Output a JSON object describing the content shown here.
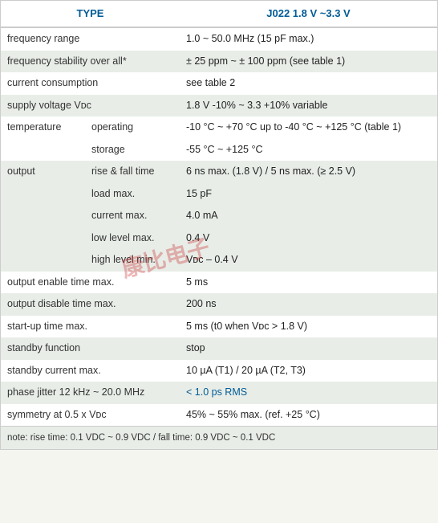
{
  "header": {
    "type_label": "TYPE",
    "model_label": "J022 1.8 V ~3.3 V"
  },
  "rows": [
    {
      "id": "frequency-range",
      "category": "frequency range",
      "sub": "",
      "value": "1.0 ~ 50.0 MHz (15 pF max.)",
      "shade": "odd"
    },
    {
      "id": "frequency-stability",
      "category": "frequency stability over all*",
      "sub": "",
      "value": "± 25 ppm ~ ± 100 ppm (see table 1)",
      "shade": "even"
    },
    {
      "id": "current-consumption",
      "category": "current consumption",
      "sub": "",
      "value": "see table 2",
      "shade": "odd"
    },
    {
      "id": "supply-voltage",
      "category": "supply voltage Vᴅᴄ",
      "sub": "",
      "value": "1.8 V -10% ~ 3.3 +10% variable",
      "shade": "even"
    }
  ],
  "temperature": {
    "category": "temperature",
    "sub_rows": [
      {
        "sub": "operating",
        "value": "-10 °C ~ +70 °C up to -40 °C ~ +125 °C (table 1)"
      },
      {
        "sub": "storage",
        "value": "-55 °C ~ +125 °C"
      }
    ],
    "shade": "odd"
  },
  "output": {
    "category": "output",
    "sub_rows": [
      {
        "sub": "rise & fall time",
        "value": "6 ns max. (1.8 V) / 5 ns max. (≥ 2.5 V)"
      },
      {
        "sub": "load max.",
        "value": "15 pF"
      },
      {
        "sub": "current max.",
        "value": "4.0 mA"
      },
      {
        "sub": "low level max.",
        "value": "0.4 V"
      },
      {
        "sub": "high level min.",
        "value": "Vᴅᴄ – 0.4 V"
      }
    ],
    "shade": "even"
  },
  "rows2": [
    {
      "id": "output-enable",
      "category": "output enable time max.",
      "value": "5 ms",
      "shade": "odd"
    },
    {
      "id": "output-disable",
      "category": "output disable time max.",
      "value": "200 ns",
      "shade": "even"
    },
    {
      "id": "startup-time",
      "category": "start-up time max.",
      "value": "5 ms (t0 when Vᴅᴄ > 1.8 V)",
      "shade": "odd"
    },
    {
      "id": "standby-function",
      "category": "standby function",
      "value": "stop",
      "shade": "even"
    },
    {
      "id": "standby-current",
      "category": "standby current max.",
      "value": "10 µA (T1) / 20 µA (T2, T3)",
      "shade": "odd"
    },
    {
      "id": "phase-jitter",
      "category": "phase jitter 12 kHz ~ 20.0 MHz",
      "value": "< 1.0 ps RMS",
      "shade": "even",
      "value_blue": true
    },
    {
      "id": "symmetry",
      "category": "symmetry at 0.5 x Vᴅᴄ",
      "value": "45% ~ 55% max. (ref. +25 °C)",
      "shade": "odd"
    }
  ],
  "note": "note: rise time: 0.1 VDC ~ 0.9 VDC / fall time: 0.9 VDC ~ 0.1 VDC",
  "watermark": "康比电子"
}
